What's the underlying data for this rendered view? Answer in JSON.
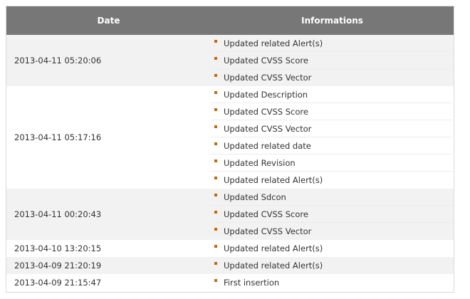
{
  "table": {
    "headers": {
      "date": "Date",
      "informations": "Informations"
    },
    "rows": [
      {
        "date": "2013-04-11 05:20:06",
        "items": [
          "Updated related Alert(s)",
          "Updated CVSS Score",
          "Updated CVSS Vector"
        ]
      },
      {
        "date": "2013-04-11 05:17:16",
        "items": [
          "Updated Description",
          "Updated CVSS Score",
          "Updated CVSS Vector",
          "Updated related date",
          "Updated Revision",
          "Updated related Alert(s)"
        ]
      },
      {
        "date": "2013-04-11 00:20:43",
        "items": [
          "Updated Sdcon",
          "Updated CVSS Score",
          "Updated CVSS Vector"
        ]
      },
      {
        "date": "2013-04-10 13:20:15",
        "items": [
          "Updated related Alert(s)"
        ]
      },
      {
        "date": "2013-04-09 21:20:19",
        "items": [
          "Updated related Alert(s)"
        ]
      },
      {
        "date": "2013-04-09 21:15:47",
        "items": [
          "First insertion"
        ]
      }
    ]
  },
  "colors": {
    "header_bg": "#777777",
    "header_text": "#ffffff",
    "stripe_bg": "#f2f2f2",
    "bullet": "#cc6600"
  },
  "icons": {
    "bullet": "square-bullet-icon"
  }
}
